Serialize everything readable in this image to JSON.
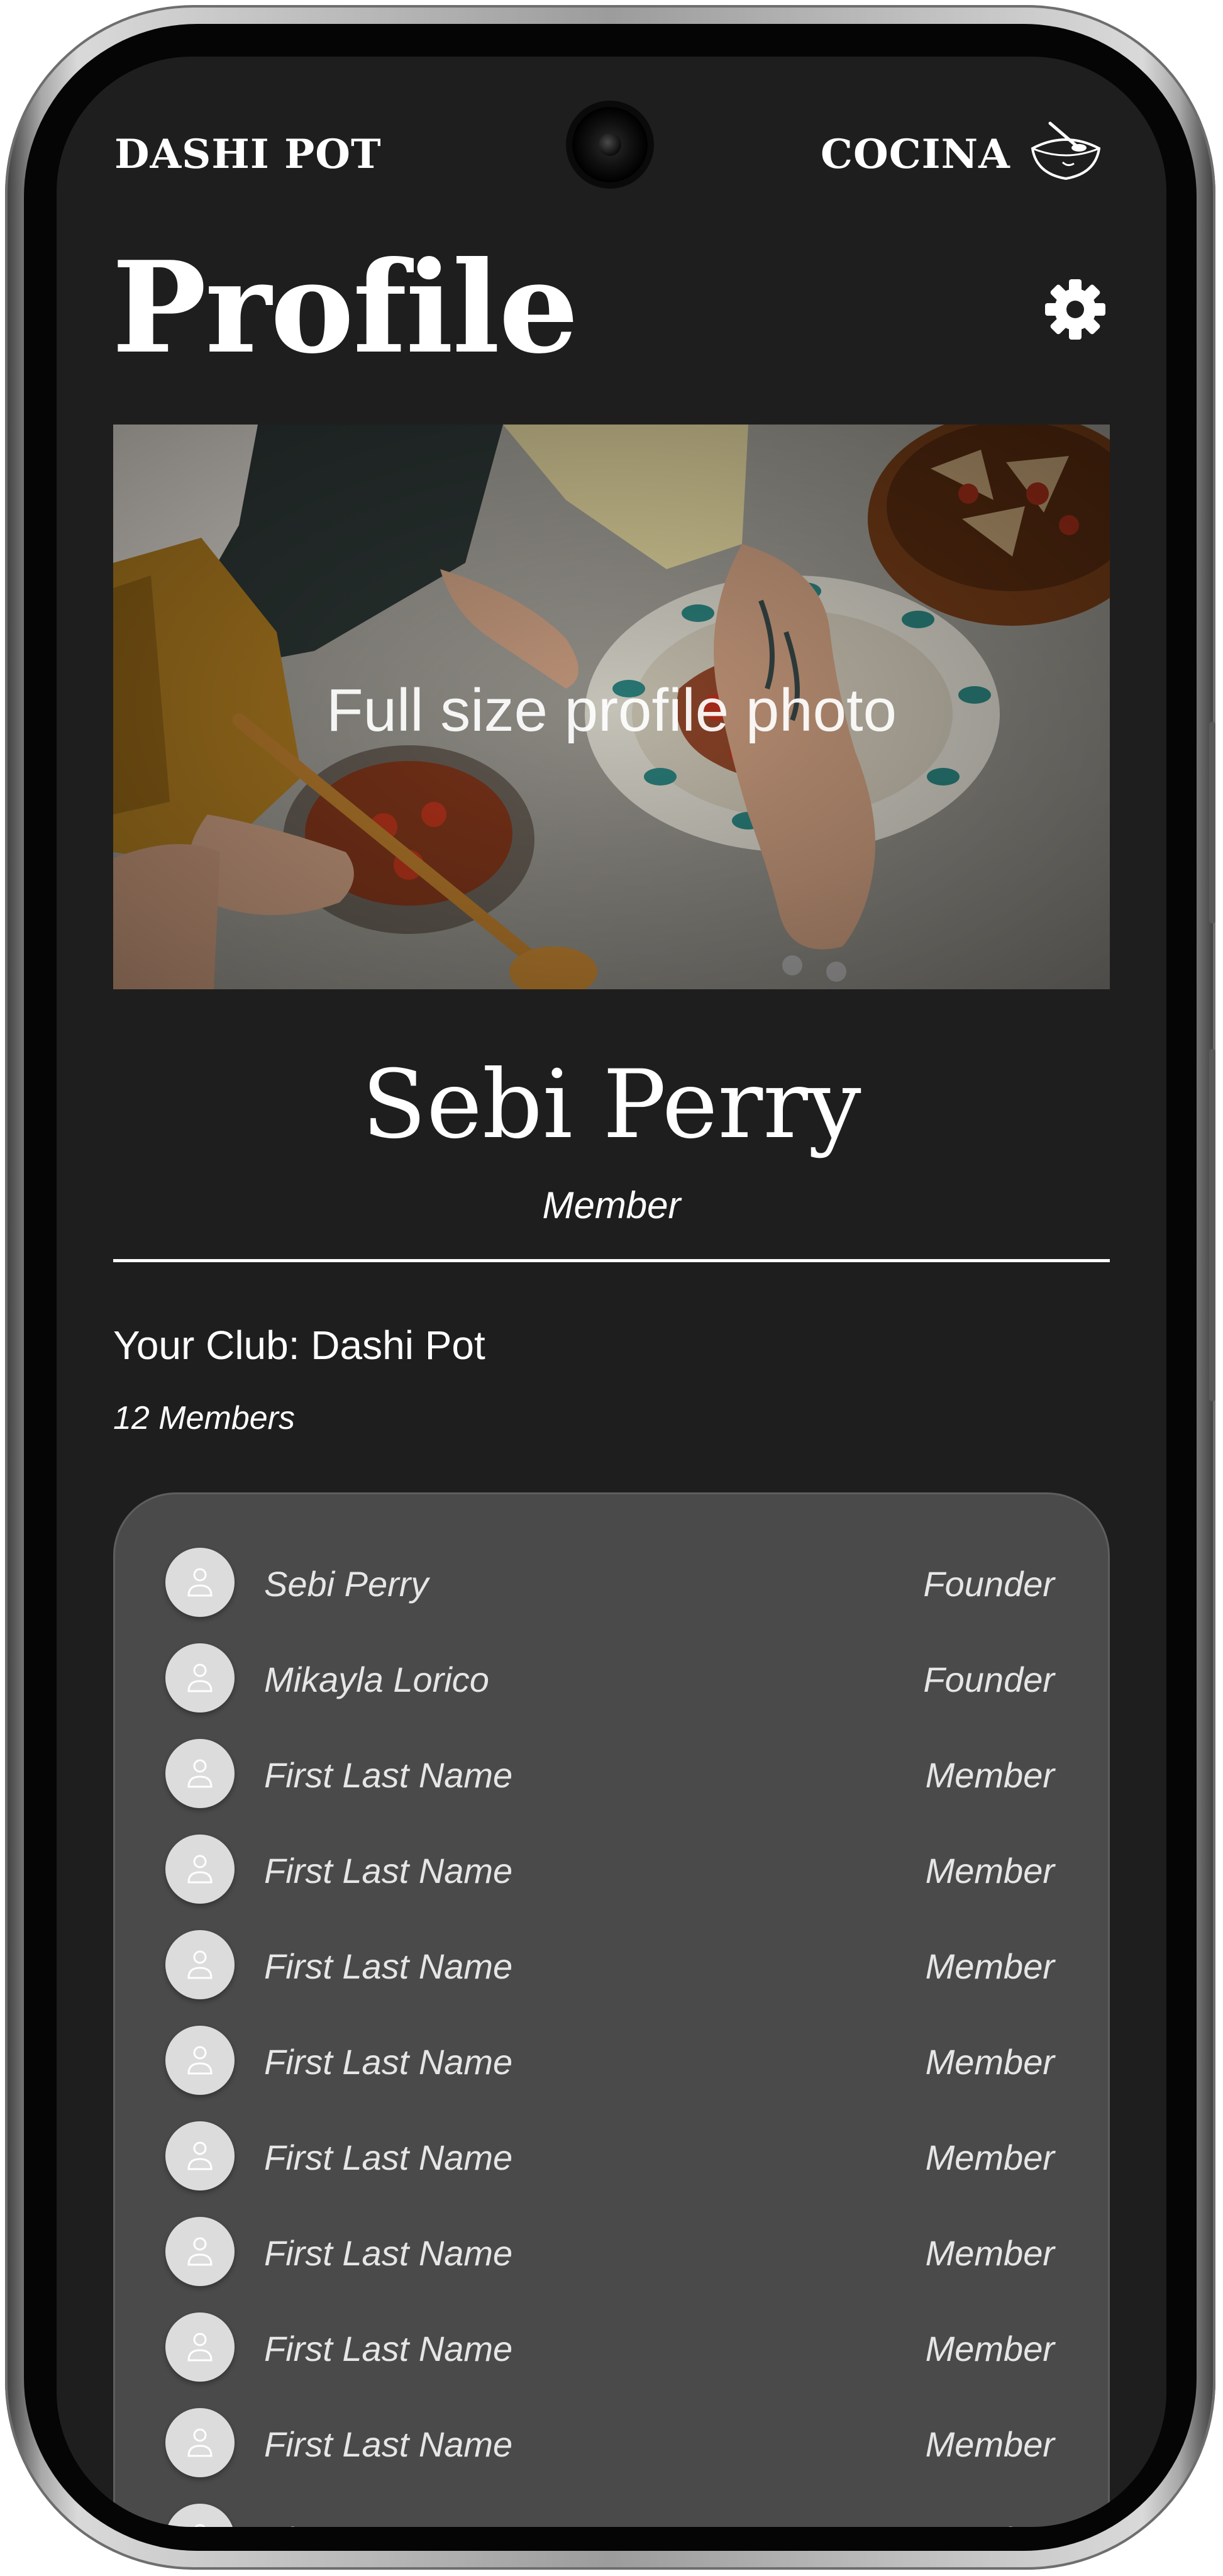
{
  "header": {
    "brand_left": "DASHI POT",
    "brand_right": "COCINA",
    "brand_icon": "bowl-icon"
  },
  "page": {
    "title": "Profile",
    "settings_icon": "gear-icon"
  },
  "photo": {
    "label": "Full size profile photo"
  },
  "profile": {
    "name": "Sebi Perry",
    "role": "Member"
  },
  "club": {
    "name_line": "Your Club: Dashi Pot",
    "member_count": "12 Members"
  },
  "members": [
    {
      "name": "Sebi Perry",
      "role": "Founder"
    },
    {
      "name": "Mikayla Lorico",
      "role": "Founder"
    },
    {
      "name": "First Last Name",
      "role": "Member"
    },
    {
      "name": "First Last Name",
      "role": "Member"
    },
    {
      "name": "First Last Name",
      "role": "Member"
    },
    {
      "name": "First Last Name",
      "role": "Member"
    },
    {
      "name": "First Last Name",
      "role": "Member"
    },
    {
      "name": "First Last Name",
      "role": "Member"
    },
    {
      "name": "First Last Name",
      "role": "Member"
    },
    {
      "name": "First Last Name",
      "role": "Member"
    },
    {
      "name": "First Last Name",
      "role": "Member"
    }
  ],
  "colors": {
    "screen_background": "#1e1e1e",
    "card_background": "#4a4a4a",
    "text": "#ffffff"
  }
}
